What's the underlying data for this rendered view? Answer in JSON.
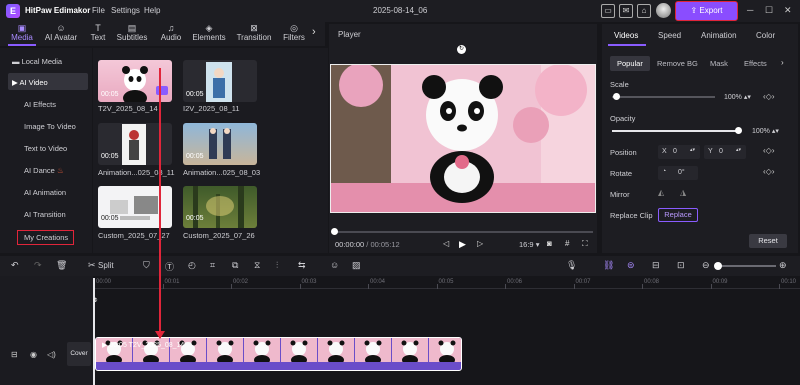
{
  "app": {
    "name": "HitPaw Edimakor",
    "project": "2025-08-14_06",
    "export_label": "Export"
  },
  "menu": [
    "File",
    "Settings",
    "Help"
  ],
  "toolbar_tabs": [
    {
      "label": "Media",
      "icon": "media-icon"
    },
    {
      "label": "AI Avatar",
      "icon": "ai-avatar-icon"
    },
    {
      "label": "Text",
      "icon": "text-icon"
    },
    {
      "label": "Subtitles",
      "icon": "subtitles-icon"
    },
    {
      "label": "Audio",
      "icon": "audio-icon"
    },
    {
      "label": "Elements",
      "icon": "elements-icon"
    },
    {
      "label": "Transition",
      "icon": "transition-icon"
    },
    {
      "label": "Filters",
      "icon": "filters-icon"
    }
  ],
  "sidebar": {
    "local_media": "Local Media",
    "ai_video": "AI Video",
    "items": [
      "AI Effects",
      "Image To Video",
      "Text to Video",
      "AI Dance",
      "AI Animation",
      "AI Transition",
      "My Creations"
    ]
  },
  "media": [
    {
      "name": "T2V_2025_08_14",
      "duration": "00:05"
    },
    {
      "name": "I2V_2025_08_11",
      "duration": "00:05"
    },
    {
      "name": "Animation...025_08_11",
      "duration": "00:05"
    },
    {
      "name": "Animation...025_08_03",
      "duration": "00:05"
    },
    {
      "name": "Custom_2025_07_27",
      "duration": "00:05"
    },
    {
      "name": "Custom_2025_07_26",
      "duration": "00:05"
    }
  ],
  "player": {
    "title": "Player",
    "current": "00:00:00",
    "total": "/ 00:05:12",
    "ratio": "16:9",
    "progress": 0.0
  },
  "right_panel": {
    "tabs": [
      "Videos",
      "Speed",
      "Animation",
      "Color"
    ],
    "subtabs": [
      "Popular",
      "Remove BG",
      "Mask",
      "Effects"
    ],
    "scale_label": "Scale",
    "scale_value": "100%",
    "scale_level": 0.04,
    "opacity_label": "Opacity",
    "opacity_value": "100%",
    "opacity_level": 1.0,
    "position_label": "Position",
    "pos_x_label": "X",
    "pos_x": "0",
    "pos_y_label": "Y",
    "pos_y": "0",
    "rotate_label": "Rotate",
    "rotate_value": "0°",
    "mirror_label": "Mirror",
    "replace_label": "Replace Clip",
    "replace_button": "Replace",
    "reset_label": "Reset"
  },
  "timeline": {
    "split_label": "Split",
    "ticks": [
      "00:00",
      "00:01",
      "00:02",
      "00:03",
      "00:04",
      "00:05",
      "00:06",
      "00:07",
      "00:08",
      "00:09",
      "00:10"
    ],
    "cover_label": "Cover",
    "clip_label": "00:05 T2V_2025_08_14"
  }
}
